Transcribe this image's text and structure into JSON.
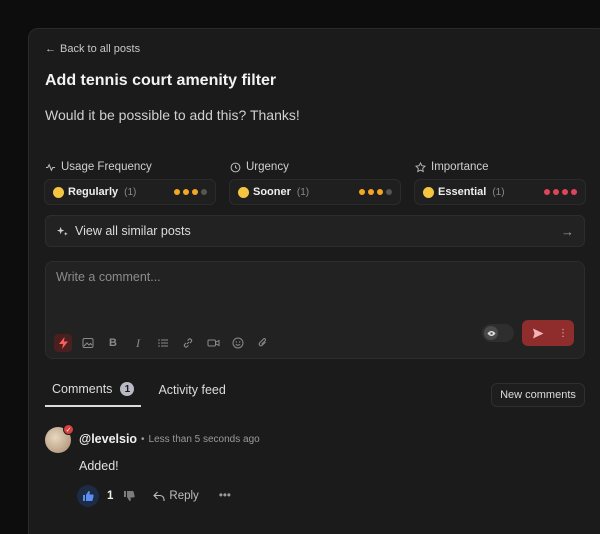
{
  "post": {
    "back_label": "Back to all posts",
    "title": "Add tennis court amenity filter",
    "description": "Would it be possible to add this? Thanks!"
  },
  "metrics": [
    {
      "label": "Usage Frequency",
      "icon": "activity-icon",
      "value": "Regularly",
      "count": "(1)",
      "level": 3,
      "max": 4,
      "color": "#f5a623"
    },
    {
      "label": "Urgency",
      "icon": "clock-icon",
      "value": "Sooner",
      "count": "(1)",
      "level": 3,
      "max": 4,
      "color": "#f5a623"
    },
    {
      "label": "Importance",
      "icon": "star-icon",
      "value": "Essential",
      "count": "(1)",
      "level": 4,
      "max": 4,
      "color": "#e0445a"
    }
  ],
  "similar_posts_label": "View all similar posts",
  "comment_box": {
    "placeholder": "Write a comment...",
    "toolbar_icons": [
      "lightning-icon",
      "image-icon",
      "bold-icon",
      "italic-icon",
      "list-icon",
      "link-icon",
      "video-icon",
      "emoji-icon",
      "attachment-icon"
    ]
  },
  "tabs": [
    {
      "label": "Comments",
      "count": "1",
      "active": true
    },
    {
      "label": "Activity feed",
      "active": false
    }
  ],
  "new_comments_label": "New comments",
  "comment": {
    "author": "@levelsio",
    "time": "Less than 5 seconds ago",
    "text": "Added!",
    "likes": "1",
    "reply_label": "Reply"
  },
  "colors": {
    "accent_red": "#8f2c2c",
    "like_blue": "#5b8ef0"
  }
}
